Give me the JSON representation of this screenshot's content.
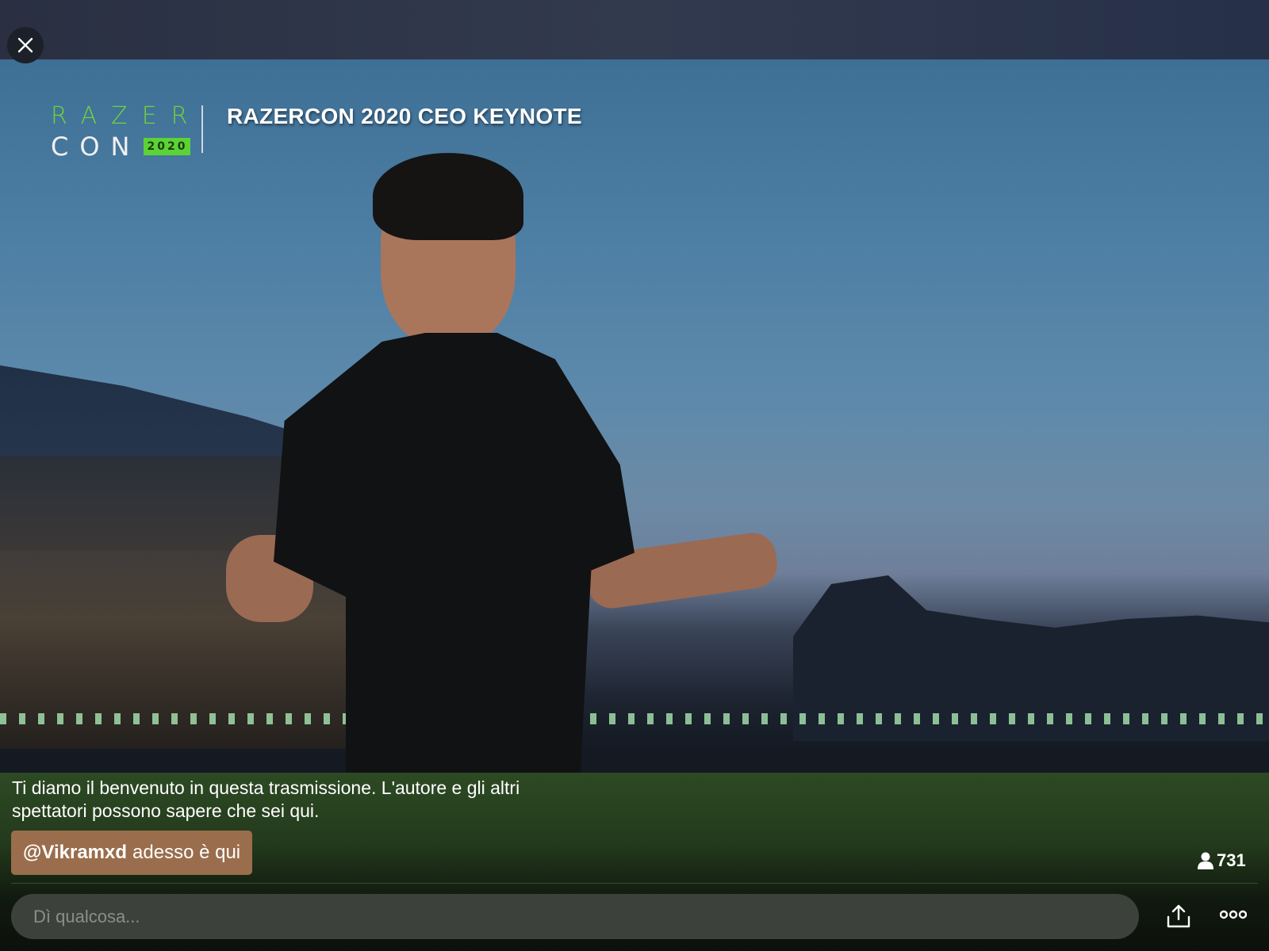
{
  "header": {
    "close_icon": "close-icon"
  },
  "video": {
    "logo": {
      "line1": "RAZER",
      "line2": "CON",
      "year_badge": "2020"
    },
    "title": "RAZERCON 2020 CEO KEYNOTE"
  },
  "chat": {
    "welcome_message": "Ti diamo il benvenuto in questa trasmissione. L'autore e gli altri spettatori possono sapere che sei qui.",
    "join_notice": {
      "username": "@Vikramxd",
      "text": "adesso è qui"
    },
    "viewer_count": "731",
    "input_placeholder": "Dì qualcosa...",
    "accent_pill_color": "#9a6d4c"
  },
  "actions": {
    "share_icon": "share-icon",
    "more_icon": "more-icon"
  }
}
